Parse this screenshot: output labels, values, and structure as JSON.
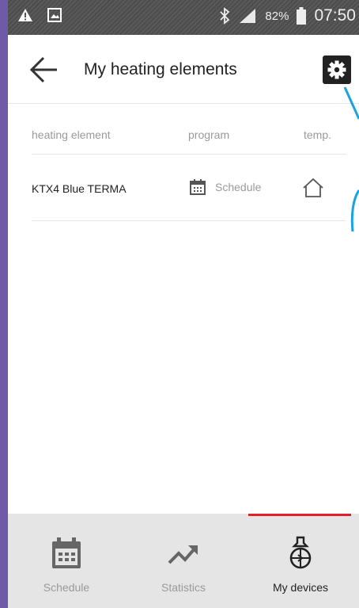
{
  "status_bar": {
    "battery_percent": "82%",
    "time": "07:50"
  },
  "header": {
    "title": "My heating elements"
  },
  "table": {
    "columns": [
      "heating element",
      "program",
      "temp."
    ],
    "rows": [
      {
        "name": "KTX4 Blue TERMA",
        "program": "Schedule"
      }
    ]
  },
  "bottom_nav": {
    "items": [
      {
        "label": "Schedule"
      },
      {
        "label": "Statistics"
      },
      {
        "label": "My devices"
      }
    ],
    "active_index": 2
  },
  "colors": {
    "active_indicator": "#e0202c",
    "annotation_line": "#1aa3e0",
    "status_bar": "#555555"
  }
}
